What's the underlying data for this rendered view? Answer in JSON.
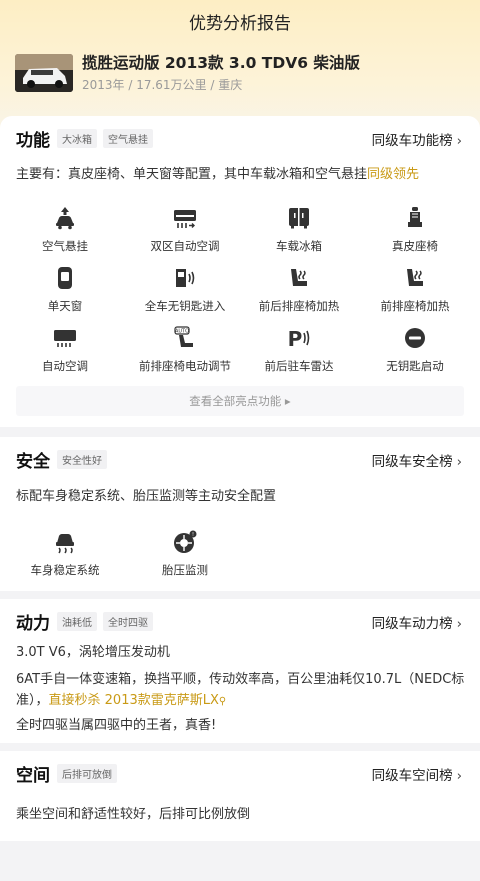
{
  "page": {
    "title": "优势分析报告"
  },
  "car": {
    "name": "揽胜运动版 2013款 3.0 TDV6 柴油版",
    "meta": "2013年 / 17.61万公里 / 重庆"
  },
  "function_section": {
    "title": "功能",
    "tags": [
      "大冰箱",
      "空气悬挂"
    ],
    "rank_link": "同级车功能榜",
    "summary_prefix": "主要有：真皮座椅、单天窗等配置，其中车载冰箱和空气悬挂",
    "summary_highlight": "同级领先",
    "features": [
      {
        "label": "空气悬挂",
        "icon": "air-suspension-icon"
      },
      {
        "label": "双区自动空调",
        "icon": "dual-zone-ac-icon"
      },
      {
        "label": "车载冰箱",
        "icon": "fridge-icon"
      },
      {
        "label": "真皮座椅",
        "icon": "leather-seat-icon"
      },
      {
        "label": "单天窗",
        "icon": "sunroof-icon"
      },
      {
        "label": "全车无钥匙进入",
        "icon": "keyless-entry-icon"
      },
      {
        "label": "前后排座椅加热",
        "icon": "seat-heat-front-rear-icon"
      },
      {
        "label": "前排座椅加热",
        "icon": "seat-heat-front-icon"
      },
      {
        "label": "自动空调",
        "icon": "auto-ac-icon"
      },
      {
        "label": "前排座椅电动调节",
        "icon": "power-seat-icon"
      },
      {
        "label": "前后驻车雷达",
        "icon": "parking-radar-icon"
      },
      {
        "label": "无钥匙启动",
        "icon": "keyless-start-icon"
      }
    ],
    "more_label": "查看全部亮点功能 ▸"
  },
  "safety_section": {
    "title": "安全",
    "tags": [
      "安全性好"
    ],
    "rank_link": "同级车安全榜",
    "summary": "标配车身稳定系统、胎压监测等主动安全配置",
    "features": [
      {
        "label": "车身稳定系统",
        "icon": "stability-control-icon"
      },
      {
        "label": "胎压监测",
        "icon": "tire-pressure-icon"
      }
    ]
  },
  "power_section": {
    "title": "动力",
    "tags": [
      "油耗低",
      "全时四驱"
    ],
    "rank_link": "同级车动力榜",
    "line1": "3.0T V6，涡轮增压发动机",
    "line2_prefix": "6AT手自一体变速箱，换挡平顺，传动效率高，百公里油耗仅10.7L（NEDC标准），",
    "line2_highlight": "直接秒杀 2013款雷克萨斯LX",
    "line3": "全时四驱当属四驱中的王者，真香!"
  },
  "space_section": {
    "title": "空间",
    "tags": [
      "后排可放倒"
    ],
    "rank_link": "同级车空间榜",
    "summary": "乘坐空间和舒适性较好，后排可比例放倒"
  },
  "colors": {
    "highlight": "#c99a16",
    "header_bg": "#fdeec4"
  }
}
